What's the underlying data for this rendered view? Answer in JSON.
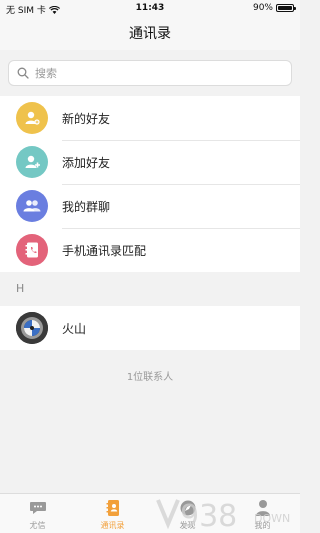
{
  "status_bar": {
    "carrier": "无 SIM 卡",
    "time": "11:43",
    "battery_text": "90%",
    "battery_level": 0.9
  },
  "nav": {
    "title": "通讯录"
  },
  "search": {
    "placeholder": "搜索"
  },
  "menu": [
    {
      "label": "新的好友",
      "icon": "new-friend-icon",
      "color": "#efc24c"
    },
    {
      "label": "添加好友",
      "icon": "add-friend-icon",
      "color": "#74c8c4"
    },
    {
      "label": "我的群聊",
      "icon": "group-chat-icon",
      "color": "#6a7ee0"
    },
    {
      "label": "手机通讯录匹配",
      "icon": "phone-contacts-icon",
      "color": "#e3637a"
    }
  ],
  "section": {
    "header": "H"
  },
  "contacts": [
    {
      "name": "火山"
    }
  ],
  "contact_count": "1位联系人",
  "tabs": [
    {
      "label": "尤信",
      "icon": "chat-bubble-icon",
      "active": false
    },
    {
      "label": "通讯录",
      "icon": "contacts-book-icon",
      "active": true
    },
    {
      "label": "发现",
      "icon": "compass-icon",
      "active": false
    },
    {
      "label": "我的",
      "icon": "person-icon",
      "active": false
    }
  ],
  "watermark": {
    "text_number": "938",
    "text_word": "DOWN"
  },
  "colors": {
    "accent": "#f2a03a",
    "background": "#f2f2f2"
  }
}
